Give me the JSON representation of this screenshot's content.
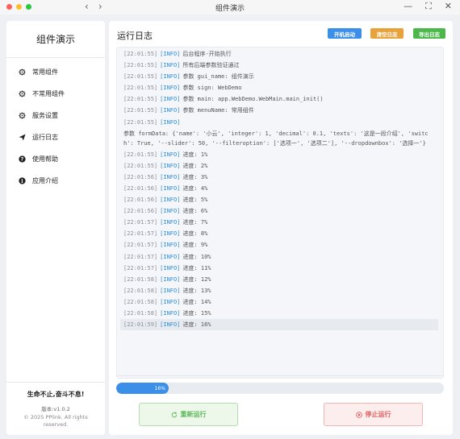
{
  "window": {
    "title": "组件演示",
    "back_arrow": "‹",
    "forward_arrow": "›",
    "minimize": "—",
    "maximize": "⛶",
    "close": "✕"
  },
  "sidebar": {
    "title": "组件演示",
    "items": [
      {
        "label": "常用组件",
        "icon": "gear-icon"
      },
      {
        "label": "不常用组件",
        "icon": "gear-icon"
      },
      {
        "label": "服务设置",
        "icon": "gear-icon"
      },
      {
        "label": "运行日志",
        "icon": "send-icon"
      },
      {
        "label": "使用帮助",
        "icon": "help-icon"
      },
      {
        "label": "应用介绍",
        "icon": "info-icon"
      }
    ],
    "slogan": "生命不止,奋斗不息!",
    "version": "版本:v1.0.2",
    "copyright_line1": "© 2025 PPlink. All rights",
    "copyright_line2": "reserved."
  },
  "main": {
    "title": "运行日志",
    "buttons": {
      "autostart": {
        "label": "开机启动",
        "color": "#3b8fe8"
      },
      "clear": {
        "label": "清空日志",
        "color": "#e8a23b"
      },
      "export": {
        "label": "导出日志",
        "color": "#4cb84c"
      }
    },
    "logs": [
      {
        "time": "[22:01:55]",
        "level": "[INFO]",
        "message": "后台程序-开始执行"
      },
      {
        "time": "[22:01:55]",
        "level": "[INFO]",
        "message": "所有后端参数验证通过"
      },
      {
        "time": "[22:01:55]",
        "level": "[INFO]",
        "message": "参数 gui_name: 组件演示"
      },
      {
        "time": "[22:01:55]",
        "level": "[INFO]",
        "message": "参数 sign: WebDemo"
      },
      {
        "time": "[22:01:55]",
        "level": "[INFO]",
        "message": "参数 main: app.WebDemo.WebMain.main_init()"
      },
      {
        "time": "[22:01:55]",
        "level": "[INFO]",
        "message": "参数 menuName: 常用组件"
      },
      {
        "time": "[22:01:55]",
        "level": "[INFO]",
        "message": ""
      },
      {
        "time": "",
        "level": "",
        "message": "参数 formData: {'name': '小云', 'integer': 1, 'decimal': 0.1, 'texts': '这是一段介绍', 'switch': True, '--slider': 50, '--filteroption': ['选项一', '选项二'], '--dropdownbox': '选择一'}"
      },
      {
        "time": "[22:01:55]",
        "level": "[INFO]",
        "message": "进度: 1%"
      },
      {
        "time": "[22:01:55]",
        "level": "[INFO]",
        "message": "进度: 2%"
      },
      {
        "time": "[22:01:56]",
        "level": "[INFO]",
        "message": "进度: 3%"
      },
      {
        "time": "[22:01:56]",
        "level": "[INFO]",
        "message": "进度: 4%"
      },
      {
        "time": "[22:01:56]",
        "level": "[INFO]",
        "message": "进度: 5%"
      },
      {
        "time": "[22:01:56]",
        "level": "[INFO]",
        "message": "进度: 6%"
      },
      {
        "time": "[22:01:57]",
        "level": "[INFO]",
        "message": "进度: 7%"
      },
      {
        "time": "[22:01:57]",
        "level": "[INFO]",
        "message": "进度: 8%"
      },
      {
        "time": "[22:01:57]",
        "level": "[INFO]",
        "message": "进度: 9%"
      },
      {
        "time": "[22:01:57]",
        "level": "[INFO]",
        "message": "进度: 10%"
      },
      {
        "time": "[22:01:57]",
        "level": "[INFO]",
        "message": "进度: 11%"
      },
      {
        "time": "[22:01:58]",
        "level": "[INFO]",
        "message": "进度: 12%"
      },
      {
        "time": "[22:01:58]",
        "level": "[INFO]",
        "message": "进度: 13%"
      },
      {
        "time": "[22:01:58]",
        "level": "[INFO]",
        "message": "进度: 14%"
      },
      {
        "time": "[22:01:58]",
        "level": "[INFO]",
        "message": "进度: 15%"
      },
      {
        "time": "[22:01:59]",
        "level": "[INFO]",
        "message": "进度: 16%"
      }
    ],
    "progress": {
      "value": 16,
      "label": "16%"
    },
    "rerun": {
      "label": "重新运行",
      "color": "#5cb85c"
    },
    "stop": {
      "label": "停止运行",
      "color": "#e06060"
    }
  }
}
